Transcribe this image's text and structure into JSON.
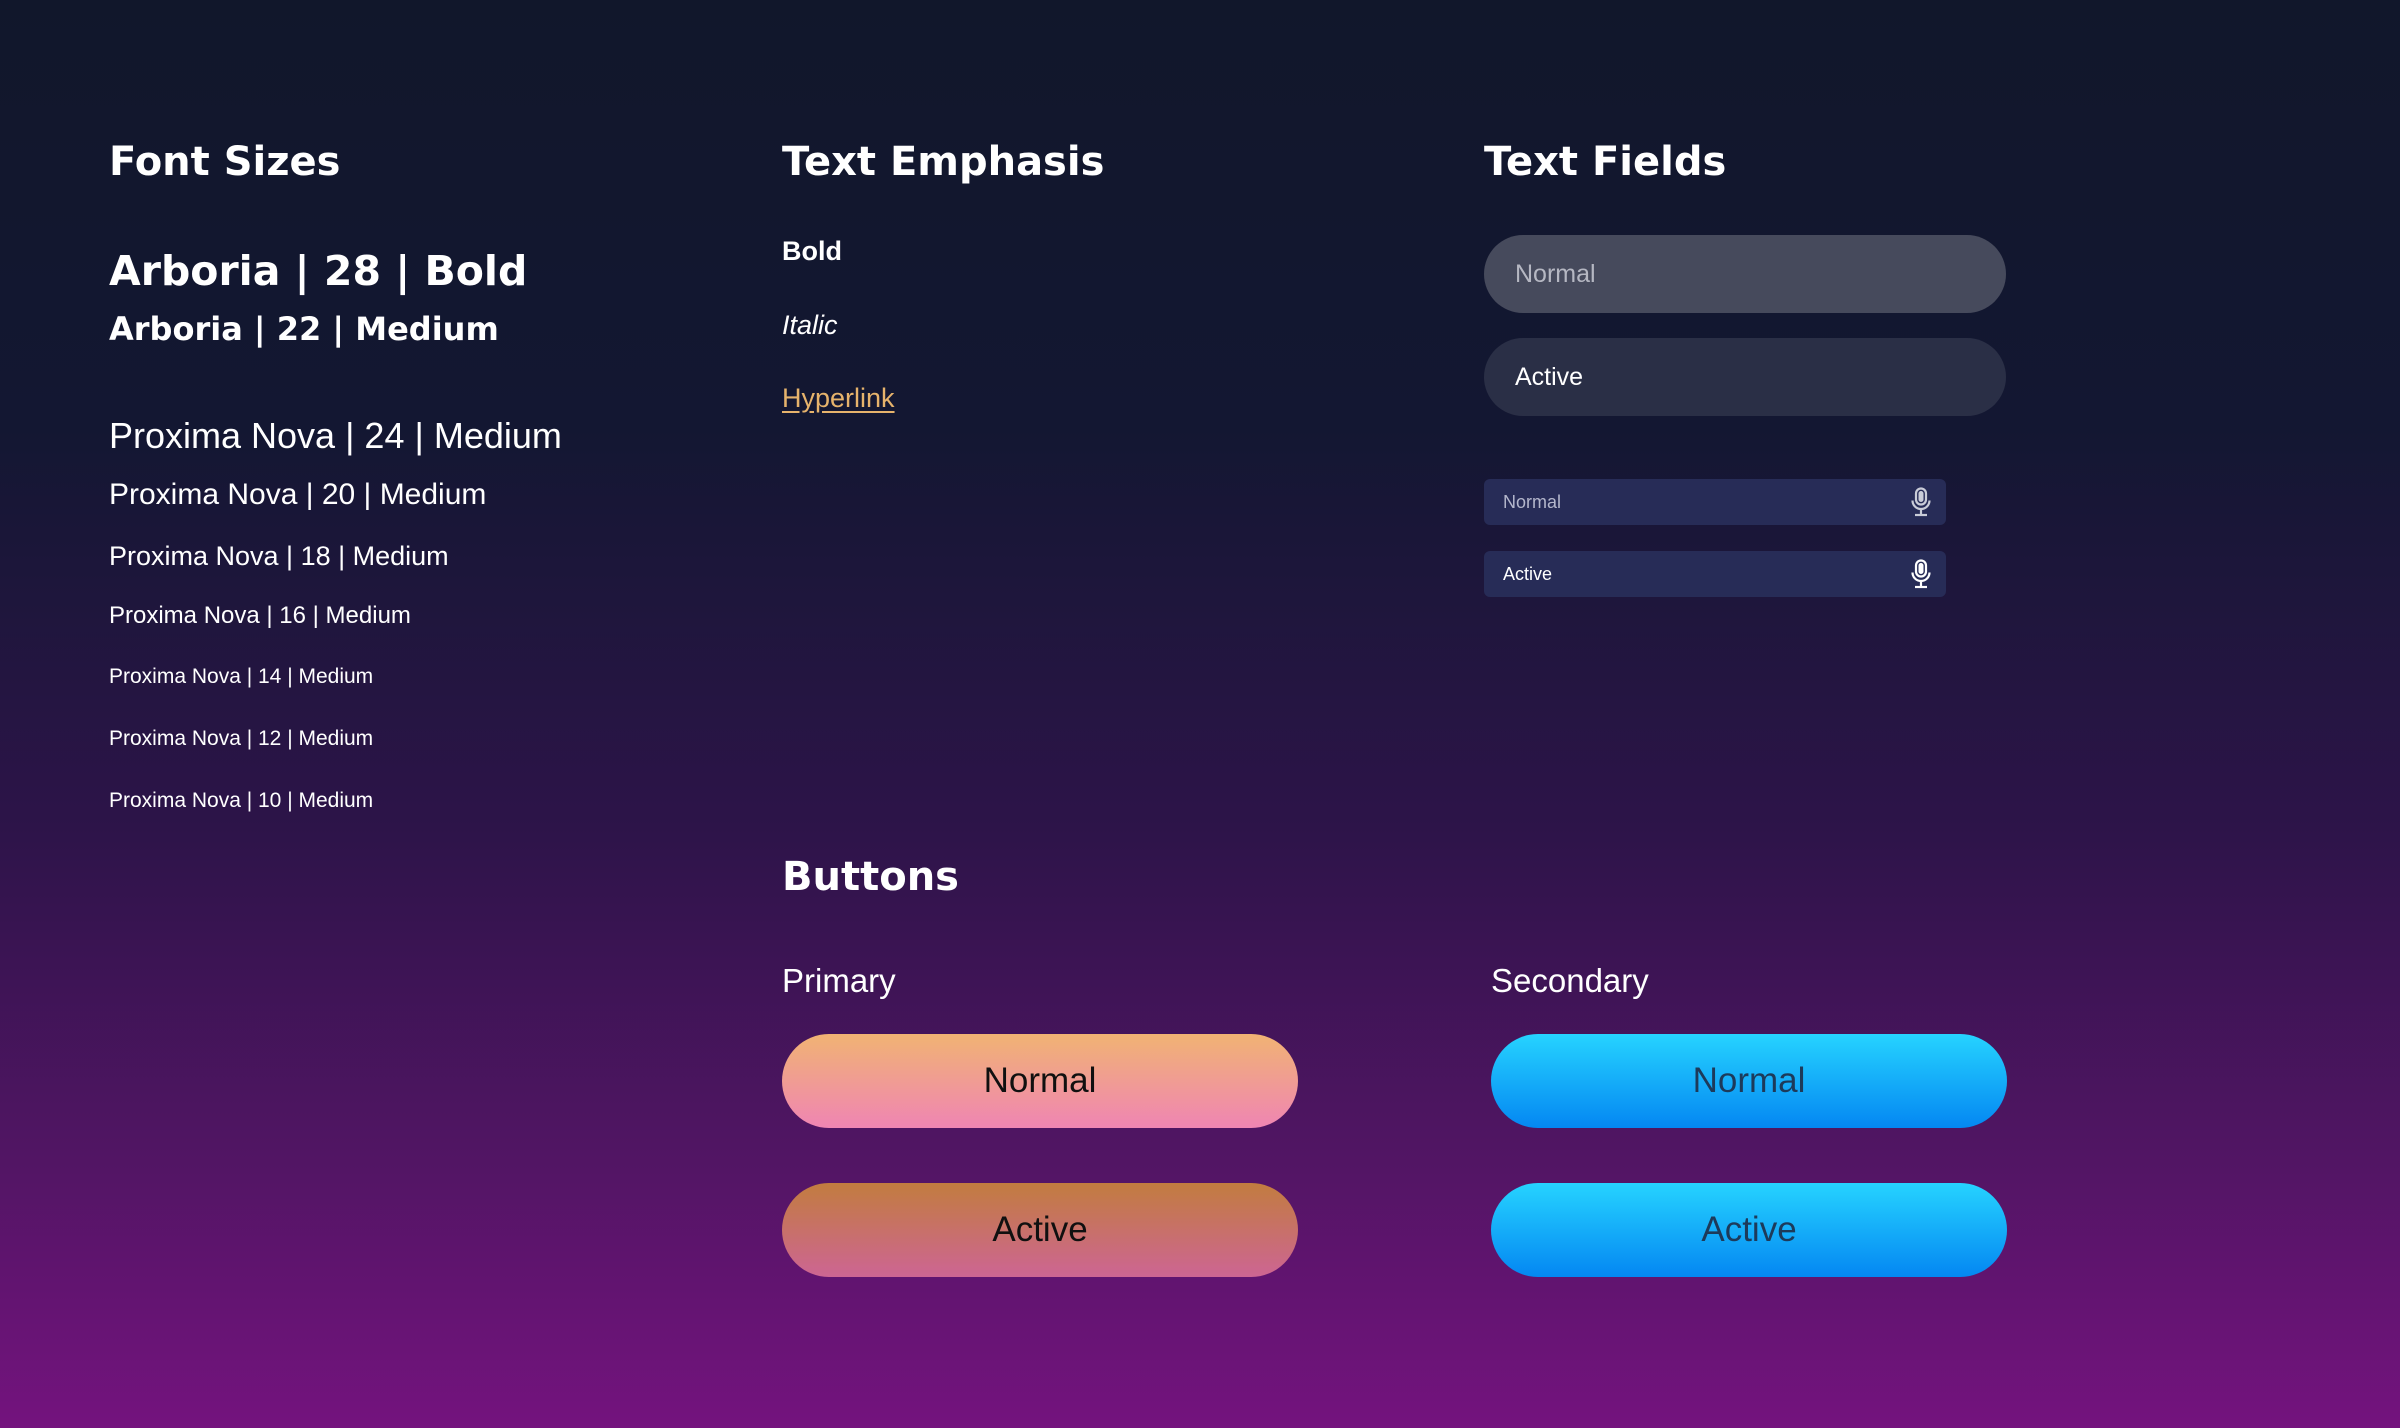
{
  "sections": {
    "font_sizes": {
      "title": "Font Sizes",
      "samples": [
        "Arboria | 28 | Bold",
        "Arboria | 22 | Medium",
        "Proxima Nova | 24 | Medium",
        "Proxima Nova | 20 | Medium",
        "Proxima Nova | 18 | Medium",
        "Proxima Nova | 16 | Medium",
        "Proxima Nova | 14 | Medium",
        "Proxima Nova | 12 | Medium",
        "Proxima Nova | 10 | Medium"
      ]
    },
    "text_emphasis": {
      "title": "Text Emphasis",
      "bold": "Bold",
      "italic": "Italic",
      "hyperlink": "Hyperlink"
    },
    "text_fields": {
      "title": "Text Fields",
      "large_normal": "Normal",
      "large_active": "Active",
      "small_normal": "Normal",
      "small_active": "Active"
    },
    "buttons": {
      "title": "Buttons",
      "primary_label": "Primary",
      "secondary_label": "Secondary",
      "primary_normal": "Normal",
      "primary_active": "Active",
      "secondary_normal": "Normal",
      "secondary_active": "Active"
    }
  },
  "colors": {
    "link": "#e6b36c",
    "primary_gradient": [
      "#f1b373",
      "#ef85b3"
    ],
    "primary_active_gradient": [
      "#c27c3f",
      "#cd6593"
    ],
    "secondary_gradient": [
      "#26d3ff",
      "#0487f2"
    ],
    "background_gradient": [
      "#11172b",
      "#74137e"
    ]
  },
  "icons": {
    "small_field_icon": "microphone-icon"
  }
}
